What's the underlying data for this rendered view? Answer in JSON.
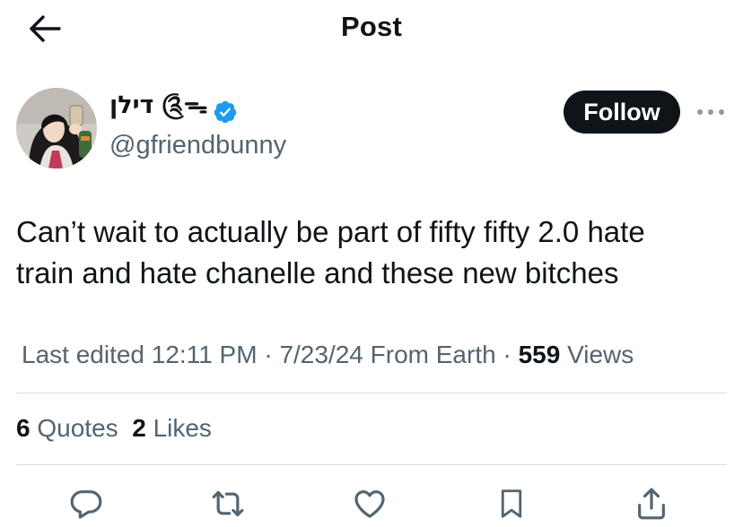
{
  "header": {
    "title": "Post",
    "back_icon": "arrow-left-icon"
  },
  "author": {
    "display_name": "דילן ༊ᯓ",
    "handle": "@gfriendbunny",
    "verified": true,
    "verified_color": "#1d9bf0"
  },
  "follow_label": "Follow",
  "more_icon": "more-horizontal-icon",
  "tweet": {
    "line1": "Can’t wait to actually be part of fifty fifty 2.0 hate",
    "line2": "train and hate chanelle and these new bitches"
  },
  "meta": {
    "edited_prefix": "Last edited",
    "time": "12:11 PM",
    "separator": "·",
    "date": "7/23/24",
    "location": "From Earth",
    "views_count": "559",
    "views_label": "Views"
  },
  "stats": {
    "quotes_count": "6",
    "quotes_label": "Quotes",
    "likes_count": "2",
    "likes_label": "Likes"
  },
  "actions": [
    "reply-icon",
    "repost-icon",
    "like-icon",
    "bookmark-icon",
    "share-icon"
  ],
  "colors": {
    "text": "#0f1419",
    "secondary": "#536471",
    "divider": "#d9dee3",
    "accent": "#1d9bf0"
  }
}
